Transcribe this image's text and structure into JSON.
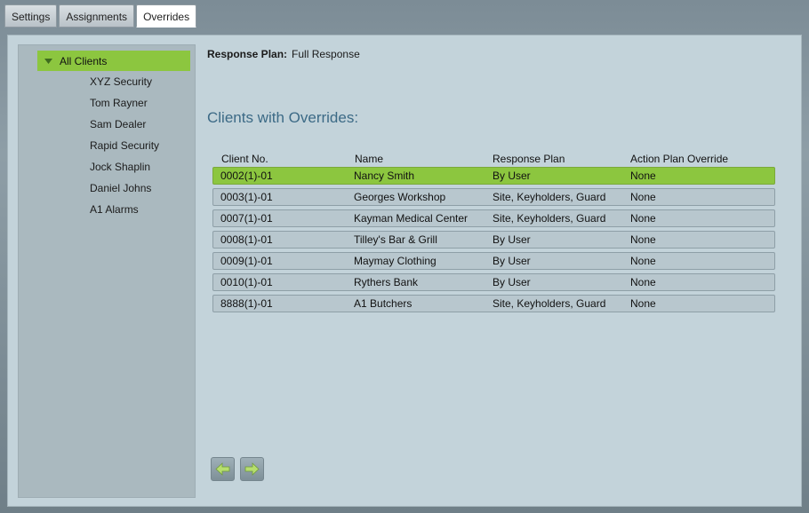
{
  "tabs": [
    "Settings",
    "Assignments",
    "Overrides"
  ],
  "active_tab": "Overrides",
  "sidebar": {
    "root_label": "All Clients",
    "clients": [
      "XYZ Security",
      "Tom Rayner",
      "Sam Dealer",
      "Rapid Security",
      "Jock Shaplin",
      "Daniel Johns",
      "A1 Alarms"
    ]
  },
  "response_plan": {
    "label": "Response Plan:",
    "value": "Full Response"
  },
  "overrides": {
    "heading": "Clients with Overrides:",
    "columns": [
      "Client No.",
      "Name",
      "Response Plan",
      "Action Plan Override"
    ],
    "rows": [
      [
        "0002(1)-01",
        "Nancy Smith",
        "By User",
        "None"
      ],
      [
        "0003(1)-01",
        "Georges Workshop",
        "Site, Keyholders, Guard",
        "None"
      ],
      [
        "0007(1)-01",
        "Kayman Medical Center",
        "Site, Keyholders, Guard",
        "None"
      ],
      [
        "0008(1)-01",
        "Tilley's Bar & Grill",
        "By User",
        "None"
      ],
      [
        "0009(1)-01",
        "Maymay Clothing",
        "By User",
        "None"
      ],
      [
        "0010(1)-01",
        "Rythers Bank",
        "By User",
        "None"
      ],
      [
        "8888(1)-01",
        "A1 Butchers",
        "Site, Keyholders, Guard",
        "None"
      ]
    ],
    "selected_row": 0
  },
  "colors": {
    "accent_green": "#8cc63f",
    "heading_blue": "#3c6a86",
    "panel_bg": "#c3d3da"
  },
  "icons": {
    "prev": "arrow-left-icon",
    "next": "arrow-right-icon",
    "tree_toggle": "triangle-down-icon"
  }
}
